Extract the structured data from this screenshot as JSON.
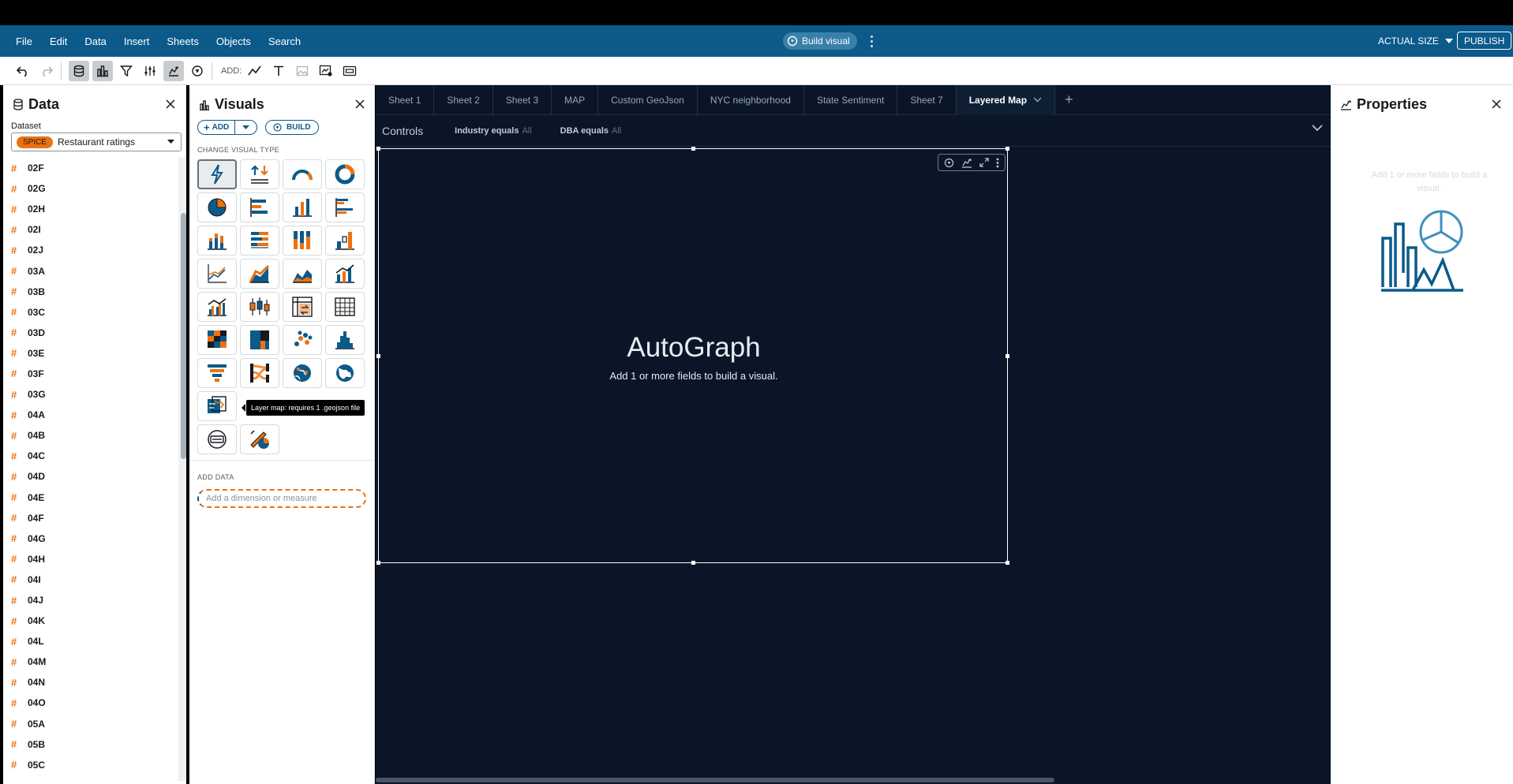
{
  "menu": [
    "File",
    "Edit",
    "Data",
    "Insert",
    "Sheets",
    "Objects",
    "Search"
  ],
  "topbar": {
    "build_visual": "Build visual",
    "actual_size": "ACTUAL SIZE",
    "publish": "PUBLISH"
  },
  "toolbar": {
    "add_label": "ADD:"
  },
  "data_panel": {
    "title": "Data",
    "dataset_label": "Dataset",
    "dataset_badge": "SPICE",
    "dataset_name": "Restaurant ratings",
    "fields": [
      "02F",
      "02G",
      "02H",
      "02I",
      "02J",
      "03A",
      "03B",
      "03C",
      "03D",
      "03E",
      "03F",
      "03G",
      "04A",
      "04B",
      "04C",
      "04D",
      "04E",
      "04F",
      "04G",
      "04H",
      "04I",
      "04J",
      "04K",
      "04L",
      "04M",
      "04N",
      "04O",
      "05A",
      "05B",
      "05C"
    ]
  },
  "visuals_panel": {
    "title": "Visuals",
    "add_button": "ADD",
    "build_button": "BUILD",
    "change_type_label": "CHANGE VISUAL TYPE",
    "tooltip": "Layer map: requires 1 .geojson file",
    "add_data_label": "ADD DATA",
    "dropzone_placeholder": "Add a dimension or measure"
  },
  "sheets": {
    "tabs": [
      "Sheet 1",
      "Sheet 2",
      "Sheet 3",
      "MAP",
      "Custom GeoJson",
      "NYC neighborhood",
      "State Sentiment",
      "Sheet 7",
      "Layered Map"
    ],
    "active": "Layered Map"
  },
  "controls": {
    "title": "Controls",
    "filters": [
      {
        "label": "Industry equals",
        "value": "All"
      },
      {
        "label": "DBA equals",
        "value": "All"
      }
    ]
  },
  "visual": {
    "title": "AutoGraph",
    "subtitle": "Add 1 or more fields to build a visual."
  },
  "properties_panel": {
    "title": "Properties",
    "hint": "Add 1 or more fields to build a visual."
  },
  "colors": {
    "brand_bar": "#0b5a8a",
    "accent_orange": "#ec7211",
    "canvas_bg": "#0a1628",
    "icon_navy": "#0b5a8a"
  }
}
